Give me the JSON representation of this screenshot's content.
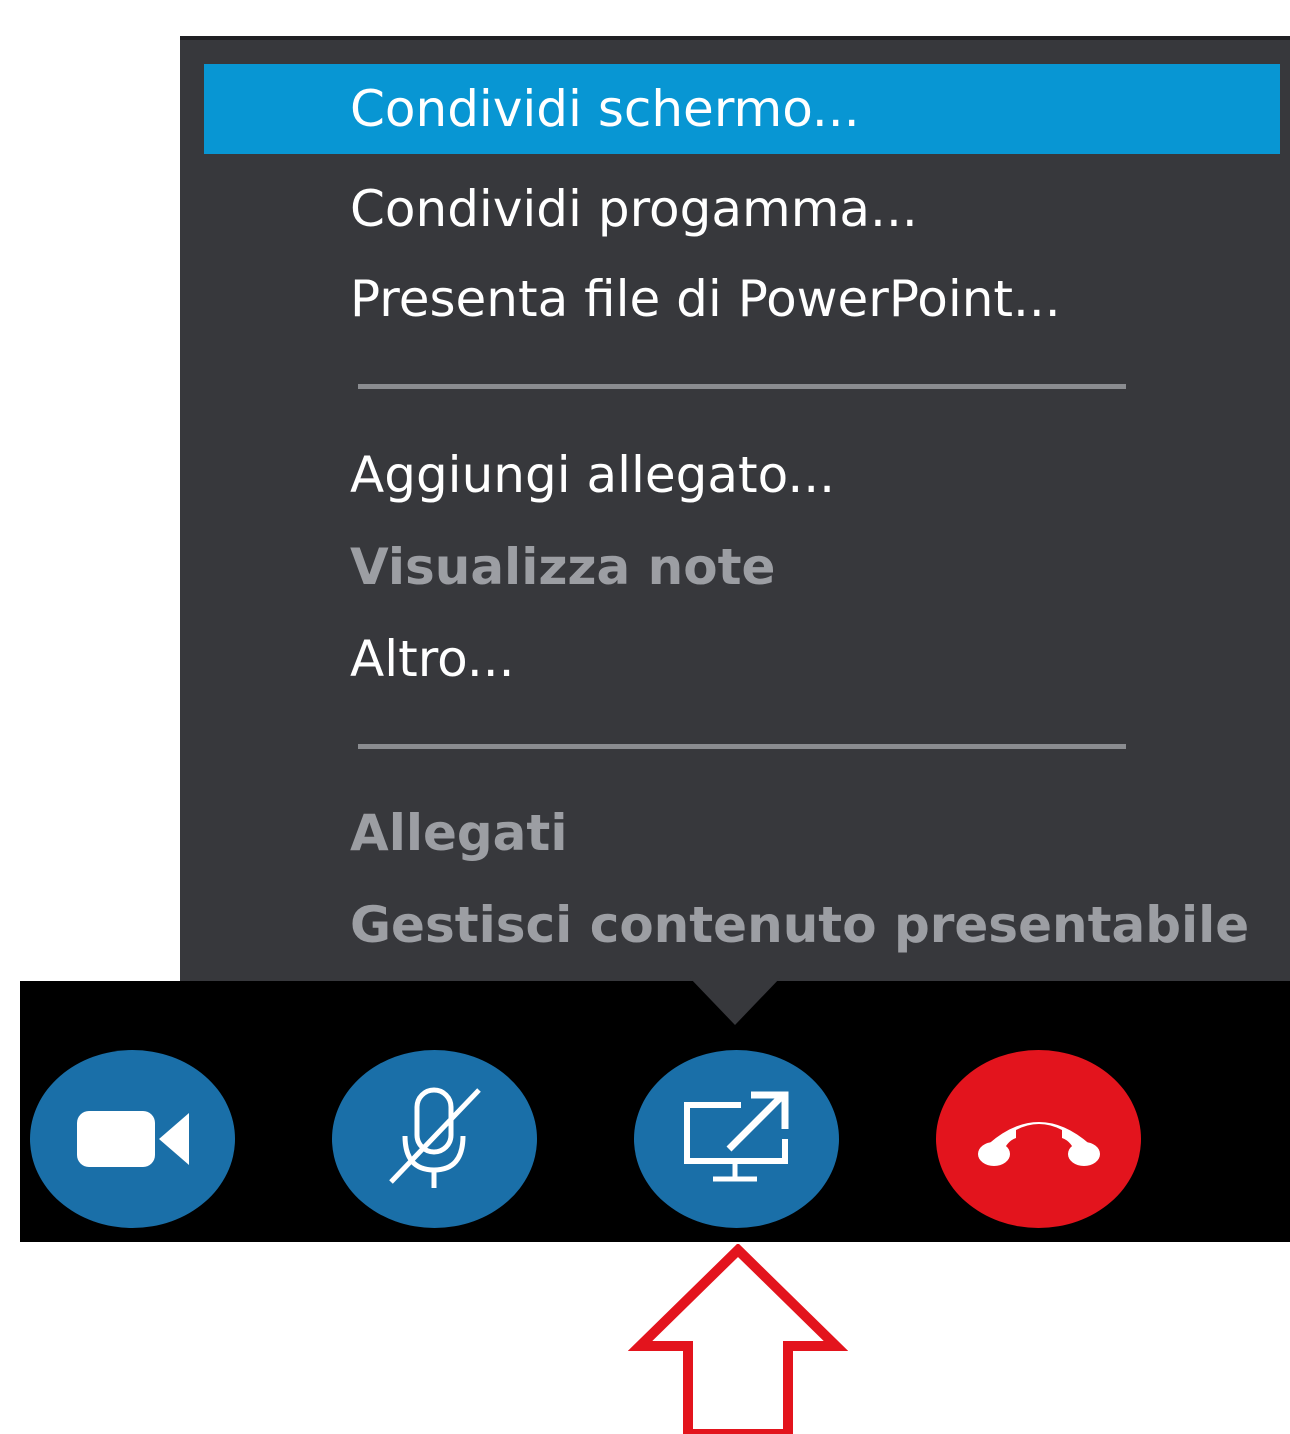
{
  "menu": {
    "items": [
      {
        "label": "Condividi schermo...",
        "enabled": true,
        "selected": true
      },
      {
        "label": "Condividi progamma...",
        "enabled": true,
        "selected": false
      },
      {
        "label": "Presenta file di PowerPoint...",
        "enabled": true,
        "selected": false
      },
      {
        "label": "Aggiungi allegato...",
        "enabled": true,
        "selected": false
      },
      {
        "label": "Visualizza note",
        "enabled": false,
        "selected": false
      },
      {
        "label": "Altro...",
        "enabled": true,
        "selected": false
      },
      {
        "label": "Allegati",
        "enabled": false,
        "selected": false
      },
      {
        "label": "Gestisci contenuto presentabile",
        "enabled": false,
        "selected": false
      }
    ]
  },
  "toolbar": {
    "buttons": [
      {
        "name": "video-camera-button",
        "icon": "video-camera-icon",
        "color": "#1a6fa8"
      },
      {
        "name": "mute-microphone-button",
        "icon": "microphone-muted-icon",
        "color": "#1a6fa8"
      },
      {
        "name": "share-screen-button",
        "icon": "share-screen-icon",
        "color": "#1a6fa8"
      },
      {
        "name": "hang-up-button",
        "icon": "hang-up-phone-icon",
        "color": "#e3141d"
      }
    ]
  },
  "annotation": {
    "icon": "red-outline-up-arrow",
    "color": "#e3141d"
  },
  "colors": {
    "menu_background": "#37383c",
    "selection": "#0896d3",
    "disabled_text": "#9c9ea3",
    "toolbar_background": "#000000"
  }
}
